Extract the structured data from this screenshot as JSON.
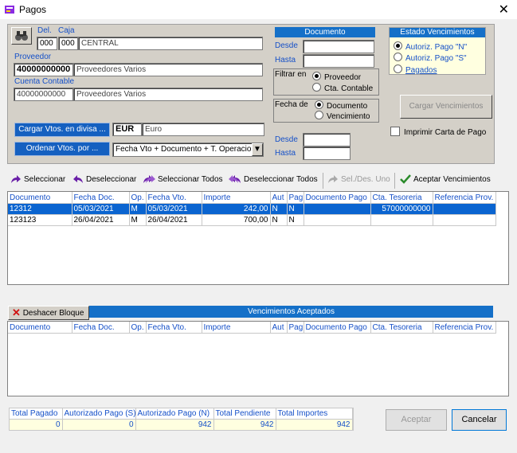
{
  "window": {
    "title": "Pagos",
    "close": "✕"
  },
  "header": {
    "del_label": "Del.",
    "caja_label": "Caja",
    "del_value": "000",
    "caja_code": "000",
    "caja_name": "CENTRAL",
    "proveedor_label": "Proveedor",
    "proveedor_code": "40000000000",
    "proveedor_name": "Proveedores Varios",
    "cuenta_label": "Cuenta Contable",
    "cuenta_code": "40000000000",
    "cuenta_name": "Proveedores Varios",
    "cargar_divisa_btn": "Cargar Vtos. en divisa ...",
    "divisa_code": "EUR",
    "divisa_name": "Euro",
    "ordenar_btn": "Ordenar Vtos. por ...",
    "ordenar_value": "Fecha Vto + Documento + T. Operacion"
  },
  "documento": {
    "title": "Documento",
    "desde": "Desde",
    "hasta": "Hasta",
    "desde_value": "",
    "hasta_value": ""
  },
  "filtrar": {
    "label": "Filtrar en",
    "options": [
      "Proveedor",
      "Cta. Contable"
    ],
    "selected": 0
  },
  "fecha_de": {
    "label": "Fecha de",
    "options": [
      "Documento",
      "Vencimiento"
    ],
    "selected": 0
  },
  "fecha_range": {
    "desde": "Desde",
    "hasta": "Hasta"
  },
  "estado": {
    "title": "Estado Vencimientos",
    "options": [
      "Autoriz. Pago \"N\"",
      "Autoriz. Pago \"S\"",
      "Pagados"
    ],
    "selected": 0
  },
  "cargar_btn": "Cargar Vencimientos",
  "imprimir_label": "Imprimir Carta de Pago",
  "toolbar": {
    "seleccionar": "Seleccionar",
    "deseleccionar": "Deseleccionar",
    "seleccionar_todos": "Seleccionar Todos",
    "deseleccionar_todos": "Deseleccionar Todos",
    "sel_des_uno": "Sel./Des. Uno",
    "aceptar_venc": "Aceptar Vencimientos"
  },
  "columns": [
    "Documento",
    "Fecha Doc.",
    "Op.",
    "Fecha Vto.",
    "Importe",
    "Aut",
    "Pag",
    "Documento Pago",
    "Cta. Tesoreria",
    "Referencia Prov."
  ],
  "rows": [
    [
      "12312",
      "05/03/2021",
      "M",
      "05/03/2021",
      "242,00",
      "N",
      "N",
      "",
      "57000000000",
      ""
    ],
    [
      "123123",
      "26/04/2021",
      "M",
      "26/04/2021",
      "700,00",
      "N",
      "N",
      "",
      "",
      ""
    ]
  ],
  "deshacer_btn": "Deshacer Bloque",
  "aceptados_title": "Vencimientos Aceptados",
  "totals": {
    "headers": [
      "Total Pagado",
      "Autorizado Pago (S)",
      "Autorizado Pago (N)",
      "Total Pendiente",
      "Total Importes"
    ],
    "values": [
      "0",
      "0",
      "942",
      "942",
      "942"
    ]
  },
  "aceptar_btn": "Aceptar",
  "cancelar_btn": "Cancelar"
}
